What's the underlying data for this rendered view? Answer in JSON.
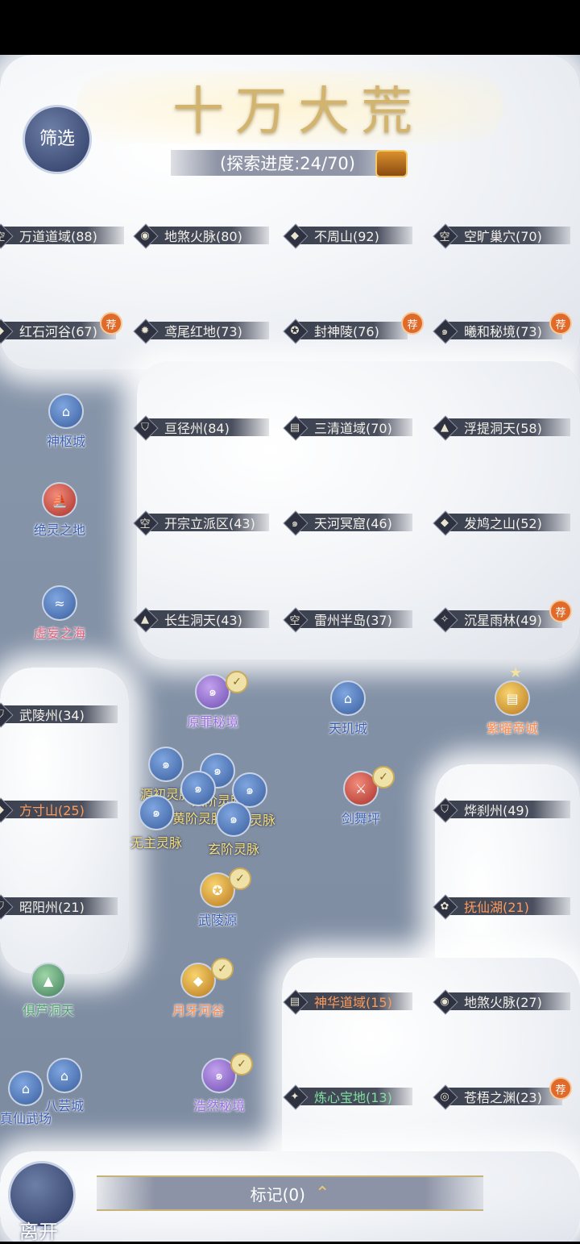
{
  "header": {
    "title": "十万大荒",
    "progress": "(探索进度:24/70)"
  },
  "filter_button": {
    "label": "筛选"
  },
  "footer": {
    "leave_label": "离开",
    "mark_label": "标记(0)"
  },
  "recommend_badge": "荐",
  "regions": {
    "r1": "万道道域(88)",
    "r2": "地煞火脉(80)",
    "r3": "不周山(92)",
    "r4": "空旷巢穴(70)",
    "r5": "红石河谷(67)",
    "r6": "鸢尾红地(73)",
    "r7": "封神陵(76)",
    "r8": "曦和秘境(73)",
    "r9": "亘径州(84)",
    "r10": "三清道域(70)",
    "r11": "浮提洞天(58)",
    "r12": "开宗立派区(43)",
    "r13": "天河冥窟(46)",
    "r14": "发鸠之山(52)",
    "r15": "长生洞天(43)",
    "r16": "雷州半岛(37)",
    "r17": "沉星雨林(49)",
    "r18": "武陵州(34)",
    "r19": "方寸山(25)",
    "r20": "烨刹州(49)",
    "r21": "昭阳州(21)",
    "r22": "抚仙湖(21)",
    "r23": "神华道域(15)",
    "r24": "地煞火脉(27)",
    "r25": "炼心宝地(13)",
    "r26": "苍梧之渊(23)"
  },
  "empty_glyph": "空",
  "locations": {
    "l1": "神枢城",
    "l2": "绝灵之地",
    "l3": "虚妄之海",
    "l4": "原罪秘境",
    "l5": "天玑城",
    "l6": "紫曜帝城",
    "l7": "源初灵脉",
    "l8": "天阶灵脉",
    "l9": "黄阶灵脉",
    "l10": "地阶灵脉",
    "l11": "无主灵脉",
    "l12": "玄阶灵脉",
    "l13": "剑舞坪",
    "l14": "武陵源",
    "l15": "俱芦洞天",
    "l16": "月牙河谷",
    "l17": "浩然秘境",
    "l18": "八芸城",
    "l19": "真仙武场"
  },
  "colors": {
    "label_bg": "#3c4150",
    "recommend": "#e06a2a",
    "title_gold": "#d2b46e",
    "water": "#8a98ab"
  }
}
